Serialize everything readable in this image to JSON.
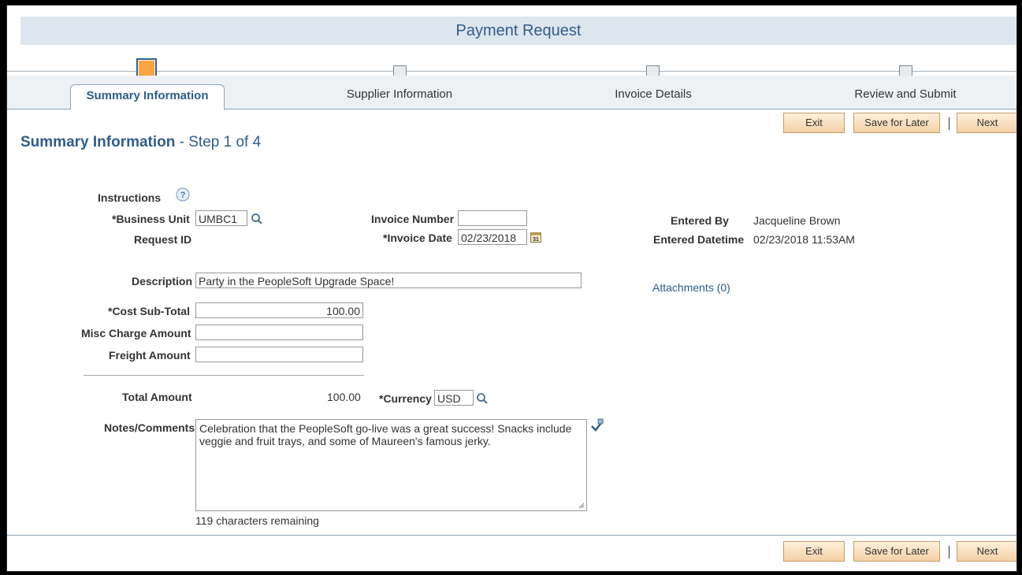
{
  "header": {
    "title": "Payment Request"
  },
  "steps": [
    {
      "label": "Summary Information",
      "active": true
    },
    {
      "label": "Supplier Information",
      "active": false
    },
    {
      "label": "Invoice Details",
      "active": false
    },
    {
      "label": "Review and Submit",
      "active": false
    }
  ],
  "toolbar": {
    "exit_label": "Exit",
    "save_label": "Save for Later",
    "next_label": "Next"
  },
  "section": {
    "title": "Summary Information",
    "step_text": " - Step 1 of 4"
  },
  "form": {
    "instructions_label": "Instructions",
    "business_unit_label": "*Business Unit",
    "business_unit_value": "UMBC1",
    "request_id_label": "Request ID",
    "invoice_number_label": "Invoice Number",
    "invoice_number_value": "",
    "invoice_date_label": "*Invoice Date",
    "invoice_date_value": "02/23/2018",
    "entered_by_label": "Entered By",
    "entered_by_value": "Jacqueline Brown",
    "entered_datetime_label": "Entered Datetime",
    "entered_datetime_value": "02/23/2018 11:53AM",
    "description_label": "Description",
    "description_value": "Party in the PeopleSoft Upgrade Space!",
    "attachments_label": "Attachments (0)",
    "cost_subtotal_label": "*Cost Sub-Total",
    "cost_subtotal_value": "100.00",
    "misc_charge_label": "Misc Charge Amount",
    "misc_charge_value": "",
    "freight_label": "Freight Amount",
    "freight_value": "",
    "total_amount_label": "Total Amount",
    "total_amount_value": "100.00",
    "currency_label": "*Currency",
    "currency_value": "USD",
    "notes_label": "Notes/Comments",
    "notes_value": "Celebration that the PeopleSoft go-live was a great success! Snacks include veggie and fruit trays, and some of Maureen's famous jerky.",
    "chars_remaining": "119 characters remaining"
  },
  "colors": {
    "accent": "#325d8b",
    "button_bg": "#f4d0a6",
    "active_step": "#f9a43f"
  }
}
